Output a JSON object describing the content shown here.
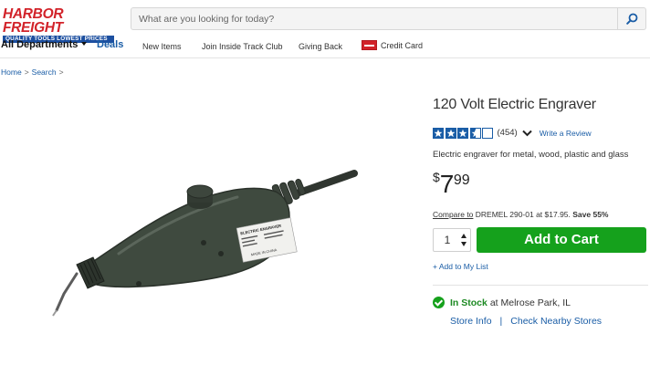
{
  "header": {
    "logo_top": "HARBOR FREIGHT",
    "logo_bottom": "QUALITY TOOLS   LOWEST PRICES",
    "search_placeholder": "What are you looking for today?"
  },
  "nav": {
    "all_departments": "All Departments",
    "deals": "Deals",
    "new_items": "New Items",
    "inside_track": "Join Inside Track Club",
    "giving_back": "Giving Back",
    "credit_card": "Credit Card"
  },
  "breadcrumb": {
    "home": "Home",
    "search": "Search"
  },
  "product": {
    "title": "120 Volt Electric Engraver",
    "rating": 3.5,
    "review_count": "(454)",
    "write_review": "Write a Review",
    "description": "Electric engraver for metal, wood, plastic and glass",
    "price_dollar": "$",
    "price_main": "7",
    "price_cents": "99",
    "compare_link": "Compare to",
    "compare_text": " DREMEL 290-01 at $17.95. ",
    "save_text": "Save 55%",
    "quantity": "1",
    "add_to_cart": "Add to Cart",
    "add_to_list": "+ Add to My List",
    "in_stock": "In Stock",
    "stock_location": "at Melrose Park, IL",
    "store_info": "Store Info",
    "separator": "|",
    "check_nearby": "Check Nearby Stores",
    "label_title": "ELECTRIC ENGRAVER",
    "label_origin": "MADE IN CHINA"
  },
  "colors": {
    "brand_red": "#d2232a",
    "brand_blue": "#1c4fa0",
    "link_blue": "#1a5da6",
    "cart_green": "#15a11c",
    "tool_body": "#3f4a3f"
  },
  "icons": {
    "search": "search-icon",
    "caret": "chevron-down-icon",
    "credit_card": "credit-card-icon",
    "star": "star-icon",
    "check": "check-circle-icon"
  }
}
